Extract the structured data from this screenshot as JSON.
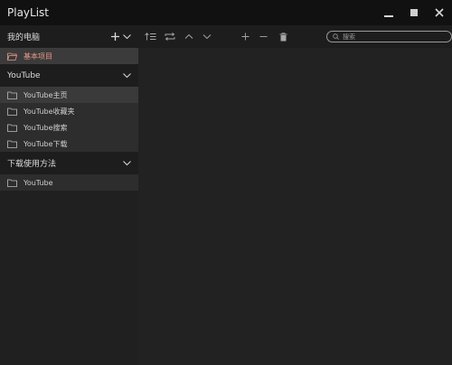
{
  "app": {
    "title": "PlayList"
  },
  "sidebar": {
    "sections": [
      {
        "label": "我的电脑",
        "items": [
          {
            "label": "基本项目",
            "selected": true
          }
        ]
      },
      {
        "label": "YouTube",
        "items": [
          {
            "label": "YouTube主页"
          },
          {
            "label": "YouTube收藏夹"
          },
          {
            "label": "YouTube搜索"
          },
          {
            "label": "YouTube下载"
          }
        ]
      },
      {
        "label": "下载使用方法",
        "items": [
          {
            "label": "YouTube"
          }
        ]
      }
    ]
  },
  "toolbar": {
    "buttons": [
      "sort-icon",
      "repeat-icon",
      "chevron-up-icon",
      "chevron-down-icon",
      "plus-icon",
      "minus-icon",
      "trash-icon"
    ]
  },
  "search": {
    "placeholder": "搜索",
    "value": ""
  },
  "colors": {
    "selected_text": "#e99a8a",
    "background": "#1b1b1b"
  }
}
